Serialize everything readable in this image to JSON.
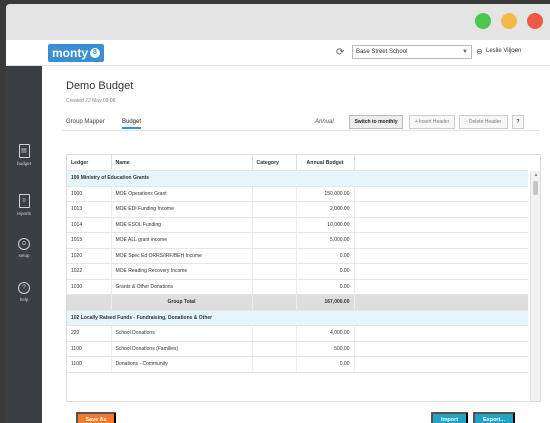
{
  "topbar": {
    "logo_text": "monty",
    "logo_badge": "8",
    "school": "Base Street School",
    "user": "Leslie Viljoen"
  },
  "sidebar": {
    "items": [
      {
        "label": "budget",
        "icon": "budget-icon"
      },
      {
        "label": "reports",
        "icon": "reports-icon"
      },
      {
        "label": "setup",
        "icon": "setup-icon"
      },
      {
        "label": "help",
        "icon": "help-icon"
      }
    ]
  },
  "page": {
    "title": "Demo Budget",
    "subtitle": "Created 22 May 09:08"
  },
  "tabs": {
    "group_mapper": "Group Mapper",
    "budget": "Budget"
  },
  "toolbar": {
    "annual": "Annual",
    "switch_label": "Switch to monthly",
    "insert_label": "+ Insert Header",
    "delete_label": "- Delete Header",
    "help_label": "?"
  },
  "table": {
    "headers": {
      "ledger": "Ledger",
      "name": "Name",
      "category": "Category",
      "annual": "Annual Budget"
    },
    "group1": {
      "title": "100 Ministry of Education Grants",
      "rows": [
        {
          "ledger": "1000",
          "name": "MOE Operations Grant",
          "category": "",
          "annual": "150,000.00"
        },
        {
          "ledger": "1013",
          "name": "MOE EDI Funding Income",
          "category": "",
          "annual": "2,000.00"
        },
        {
          "ledger": "1014",
          "name": "MOE ESOL Funding",
          "category": "",
          "annual": "10,000.00"
        },
        {
          "ledger": "1015",
          "name": "MOE ALL grant income",
          "category": "",
          "annual": "5,000.00"
        },
        {
          "ledger": "1020",
          "name": "MOE Spec Ed ORRS/IRF/BEH Income",
          "category": "",
          "annual": "0.00"
        },
        {
          "ledger": "1022",
          "name": "MOE Reading Recovery Income",
          "category": "",
          "annual": "0.00"
        },
        {
          "ledger": "1030",
          "name": "Grants & Other Donations",
          "category": "",
          "annual": "0.00"
        }
      ],
      "total_label": "Group Total",
      "total_value": "167,000.00"
    },
    "group2": {
      "title": "102 Locally Raised Funds - Fundraising, Donations & Other",
      "rows": [
        {
          "ledger": "220",
          "name": "School Donations",
          "category": "",
          "annual": "4,000.00"
        },
        {
          "ledger": "1100",
          "name": "School Donations (Families)",
          "category": "",
          "annual": "500.00"
        },
        {
          "ledger": "1100",
          "name": "Donations - Community",
          "category": "",
          "annual": "0.00"
        }
      ]
    }
  },
  "actions": {
    "save_as": "Save As",
    "import": "Import",
    "export": "Export..."
  }
}
